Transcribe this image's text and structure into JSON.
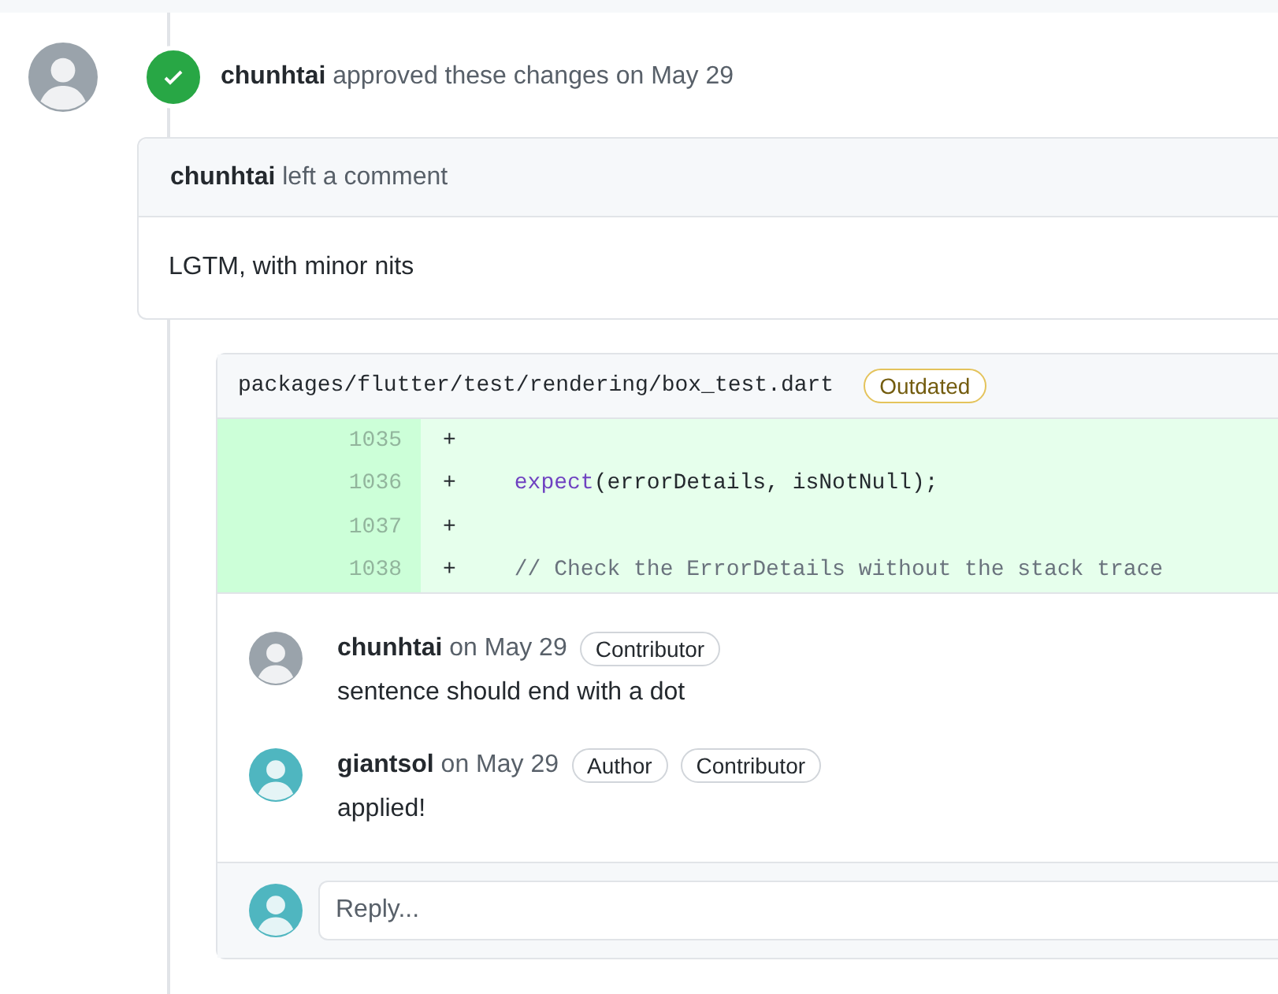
{
  "review": {
    "author": "chunhtai",
    "action": "approved these changes",
    "date": "on May 29",
    "approved": true
  },
  "comment": {
    "author": "chunhtai",
    "action": "left a comment",
    "body": "LGTM, with minor nits"
  },
  "thread": {
    "file": "packages/flutter/test/rendering/box_test.dart",
    "badge": "Outdated",
    "lines": [
      {
        "number": "1035",
        "sign": "+"
      },
      {
        "number": "1036",
        "sign": "+",
        "code": [
          {
            "kind": "function",
            "text": "expect"
          },
          {
            "kind": "plain",
            "text": "(errorDetails, isNotNull);"
          }
        ]
      },
      {
        "number": "1037",
        "sign": "+"
      },
      {
        "number": "1038",
        "sign": "+",
        "code": [
          {
            "kind": "comment",
            "text": "// Check the ErrorDetails without the stack trace"
          }
        ]
      }
    ],
    "comments": [
      {
        "author": "chunhtai",
        "date": "on May 29",
        "badges": [
          "Contributor"
        ],
        "body": "sentence should end with a dot"
      },
      {
        "author": "giantsol",
        "date": "on May 29",
        "badges": [
          "Author",
          "Contributor"
        ],
        "body": "applied!"
      }
    ],
    "reply": {
      "placeholder": "Reply..."
    }
  }
}
